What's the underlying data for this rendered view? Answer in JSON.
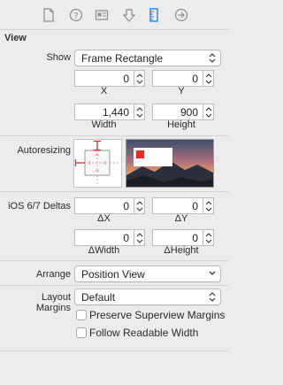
{
  "tabs": [
    {
      "name": "file-inspector",
      "icon": "file-icon"
    },
    {
      "name": "quick-help-inspector",
      "icon": "help-circle-icon"
    },
    {
      "name": "identity-inspector",
      "icon": "id-card-icon"
    },
    {
      "name": "attributes-inspector",
      "icon": "shield-down-icon"
    },
    {
      "name": "size-inspector",
      "icon": "ruler-icon",
      "active": true
    },
    {
      "name": "connections-inspector",
      "icon": "arrow-circle-icon"
    }
  ],
  "section_title": "View",
  "show": {
    "label": "Show",
    "value": "Frame Rectangle"
  },
  "frame": {
    "x": {
      "value": "0",
      "label": "X"
    },
    "y": {
      "value": "0",
      "label": "Y"
    },
    "width": {
      "value": "1,440",
      "label": "Width"
    },
    "height": {
      "value": "900",
      "label": "Height"
    }
  },
  "autoresizing": {
    "label": "Autoresizing"
  },
  "deltas": {
    "label": "iOS 6/7 Deltas",
    "dx": {
      "value": "0",
      "label": "ΔX"
    },
    "dy": {
      "value": "0",
      "label": "ΔY"
    },
    "dwidth": {
      "value": "0",
      "label": "ΔWidth"
    },
    "dheight": {
      "value": "0",
      "label": "ΔHeight"
    }
  },
  "arrange": {
    "label": "Arrange",
    "value": "Position View"
  },
  "layout_margins": {
    "label": "Layout Margins",
    "value": "Default"
  },
  "checkboxes": {
    "preserve": "Preserve Superview Margins",
    "readable": "Follow Readable Width"
  },
  "colors": {
    "accent": "#2f7fe6",
    "strut": "#d0312d"
  }
}
